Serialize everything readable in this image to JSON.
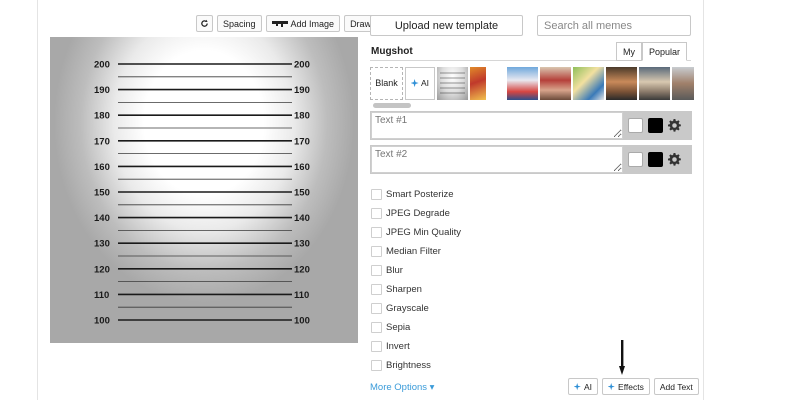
{
  "toolbar": {
    "refresh_icon": "refresh-icon",
    "spacing_label": "Spacing",
    "add_image_label": "Add Image",
    "draw_label": "Draw"
  },
  "canvas": {
    "height_labels": [
      "200",
      "190",
      "180",
      "170",
      "160",
      "150",
      "140",
      "130",
      "120",
      "110",
      "100"
    ]
  },
  "panel": {
    "upload_label": "Upload new template",
    "search_placeholder": "Search all memes",
    "template_name": "Mugshot",
    "tabs": [
      {
        "label": "My",
        "active": false
      },
      {
        "label": "Popular",
        "active": true
      }
    ],
    "blank_label": "Blank",
    "ai_label": "AI",
    "text_boxes": [
      {
        "placeholder": "Text #1",
        "color": "#ffffff",
        "outline": "#000000"
      },
      {
        "placeholder": "Text #2",
        "color": "#ffffff",
        "outline": "#000000"
      }
    ],
    "effects": [
      "Smart Posterize",
      "JPEG Degrade",
      "JPEG Min Quality",
      "Median Filter",
      "Blur",
      "Sharpen",
      "Grayscale",
      "Sepia",
      "Invert",
      "Brightness"
    ],
    "more_options": "More Options ▾",
    "bottom_buttons": {
      "ai": "AI",
      "effects": "Effects",
      "add_text": "Add Text"
    }
  },
  "colors": {
    "accent_link": "#3a9bd9",
    "sparkle": "#2e8fd6"
  }
}
